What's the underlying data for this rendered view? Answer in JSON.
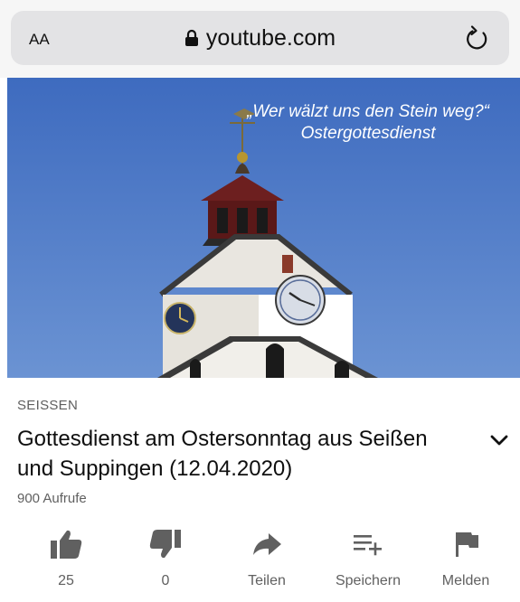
{
  "browser": {
    "text_size_label": "AA",
    "url": "youtube.com"
  },
  "thumbnail": {
    "caption_line1": "„Wer wälzt uns den Stein weg?“",
    "caption_line2": "Ostergottesdienst"
  },
  "video": {
    "channel": "SEISSEN",
    "title": "Gottesdienst am Ostersonntag aus Seißen und Suppingen (12.04.2020)",
    "views": "900 Aufrufe"
  },
  "actions": {
    "like_count": "25",
    "dislike_count": "0",
    "share_label": "Teilen",
    "save_label": "Speichern",
    "report_label": "Melden"
  },
  "colors": {
    "sky": "#4f79c4",
    "icon_gray": "#606060"
  }
}
